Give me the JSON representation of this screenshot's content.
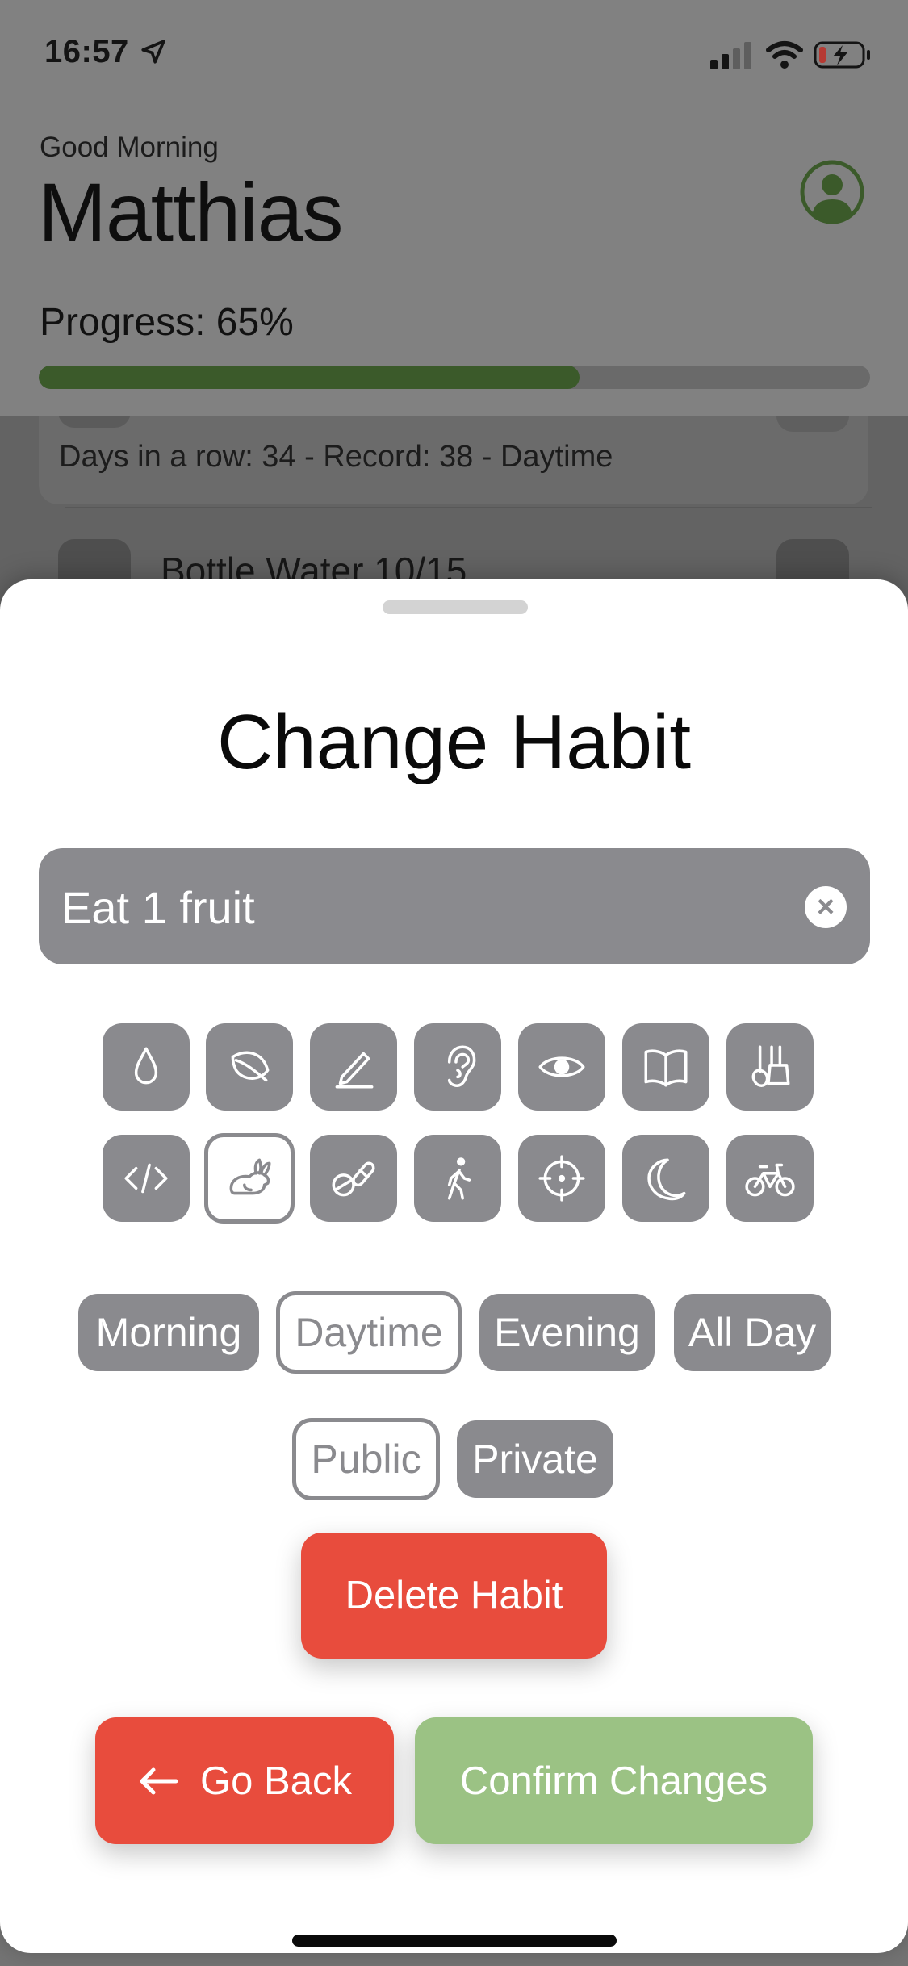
{
  "status_bar": {
    "time": "16:57"
  },
  "header": {
    "greeting": "Good Morning",
    "user_name": "Matthias",
    "progress_label": "Progress: 65%",
    "progress_value": 0.65,
    "accent_color": "#3b5a2a"
  },
  "habit_list": {
    "row1_detail": "Days in a row: 34 - Record: 38 - Daytime",
    "row2_title": "Bottle Water 10/15"
  },
  "sheet": {
    "title": "Change Habit",
    "name_value": "Eat 1 fruit",
    "icons_row1": [
      "water-drop-icon",
      "leaf-icon",
      "pencil-icon",
      "ear-icon",
      "eye-icon",
      "book-icon",
      "guitars-icon"
    ],
    "icons_row2": [
      "code-icon",
      "hare-icon",
      "pills-icon",
      "walking-figure-icon",
      "target-icon",
      "moon-icon",
      "bicycle-icon"
    ],
    "selected_icon": "hare-icon",
    "times": [
      "Morning",
      "Daytime",
      "Evening",
      "All Day"
    ],
    "selected_time": "Daytime",
    "visibility": [
      "Public",
      "Private"
    ],
    "selected_visibility": "Public",
    "delete_label": "Delete Habit",
    "back_label": "Go Back",
    "confirm_label": "Confirm Changes"
  },
  "colors": {
    "danger": "#e84c3d",
    "confirm": "#9bc284",
    "neutral": "#8a8a8e"
  }
}
